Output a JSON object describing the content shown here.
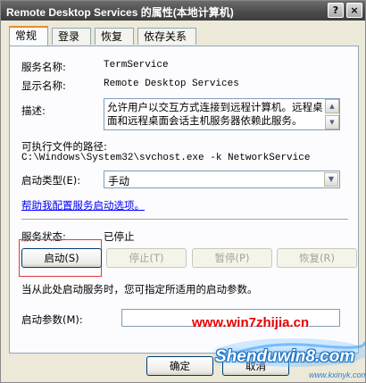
{
  "window": {
    "title": "Remote Desktop Services 的属性(本地计算机)",
    "help_glyph": "?",
    "close_glyph": "×"
  },
  "tabs": [
    {
      "label": "常规",
      "active": true
    },
    {
      "label": "登录",
      "active": false
    },
    {
      "label": "恢复",
      "active": false
    },
    {
      "label": "依存关系",
      "active": false
    }
  ],
  "general": {
    "service_name_label": "服务名称:",
    "service_name": "TermService",
    "display_name_label": "显示名称:",
    "display_name": "Remote Desktop Services",
    "description_label": "描述:",
    "description": "允许用户以交互方式连接到远程计算机。远程桌面和远程桌面会话主机服务器依赖此服务。",
    "exe_path_label": "可执行文件的路径:",
    "exe_path": "C:\\Windows\\System32\\svchost.exe -k NetworkService",
    "startup_type_label": "启动类型(E):",
    "startup_type_value": "手动",
    "help_link": "帮助我配置服务启动选项。",
    "status_label": "服务状态:",
    "status_value": "已停止",
    "start_button": "启动(S)",
    "stop_button": "停止(T)",
    "pause_button": "暂停(P)",
    "resume_button": "恢复(R)",
    "start_params_hint": "当从此处启动服务时，您可指定所适用的启动参数。",
    "start_params_label": "启动参数(M):",
    "start_params_value": ""
  },
  "footer": {
    "ok_button": "确定",
    "cancel_button": "取消"
  },
  "watermark": {
    "url": "www.win7zhijia.cn",
    "brand": "Shenduwin8.com",
    "sub": "www.kxinyk.com"
  },
  "colors": {
    "highlight_box": "#E43A3A",
    "link": "#0000FF",
    "watermark_red": "#E60000"
  }
}
